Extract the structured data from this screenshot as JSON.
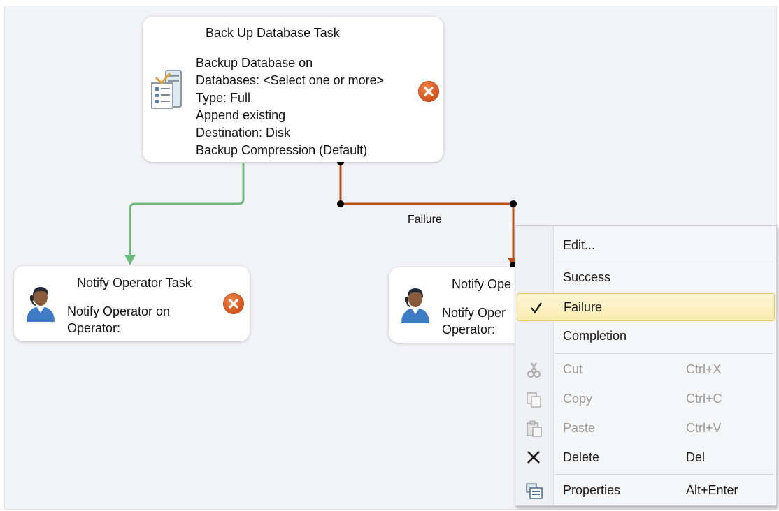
{
  "tasks": {
    "backup": {
      "title": "Back Up Database Task",
      "lines": [
        "Backup Database on",
        "Databases: <Select one or more>",
        "Type: Full",
        "Append existing",
        "Destination: Disk",
        "Backup Compression (Default)"
      ]
    },
    "notify1": {
      "title": "Notify Operator Task",
      "lines": [
        "Notify Operator on",
        "Operator:"
      ]
    },
    "notify2": {
      "title": "Notify Ope",
      "lines": [
        "Notify Oper",
        "Operator:"
      ]
    }
  },
  "connectors": {
    "failure_label": "Failure",
    "success_color": "#6cbb7c",
    "failure_color": "#b5501f"
  },
  "context_menu": {
    "items": [
      {
        "label": "Edit...",
        "shortcut": "",
        "icon": "",
        "enabled": true
      },
      {
        "label": "Success",
        "shortcut": "",
        "icon": "",
        "enabled": true
      },
      {
        "label": "Failure",
        "shortcut": "",
        "icon": "checkmark-icon",
        "enabled": true,
        "checked": true
      },
      {
        "label": "Completion",
        "shortcut": "",
        "icon": "",
        "enabled": true
      },
      {
        "label": "Cut",
        "shortcut": "Ctrl+X",
        "icon": "scissors-icon",
        "enabled": false
      },
      {
        "label": "Copy",
        "shortcut": "Ctrl+C",
        "icon": "copy-icon",
        "enabled": false
      },
      {
        "label": "Paste",
        "shortcut": "Ctrl+V",
        "icon": "paste-icon",
        "enabled": false
      },
      {
        "label": "Delete",
        "shortcut": "Del",
        "icon": "delete-x-icon",
        "enabled": true
      },
      {
        "label": "Properties",
        "shortcut": "Alt+Enter",
        "icon": "properties-icon",
        "enabled": true
      }
    ]
  }
}
